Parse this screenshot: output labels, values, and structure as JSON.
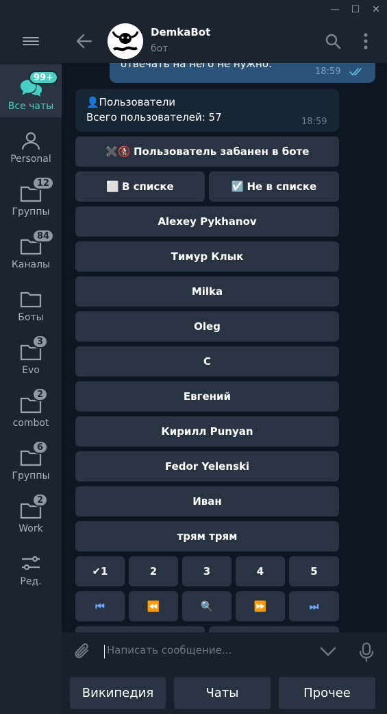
{
  "window": {
    "controls": [
      "—",
      "☐",
      "✕"
    ]
  },
  "sidebar": {
    "folders": [
      {
        "label": "Все чаты",
        "badge": "99+",
        "icon": "chat-bubbles-icon",
        "active": true
      },
      {
        "label": "Personal",
        "badge": "",
        "icon": "person-icon"
      },
      {
        "label": "Группы",
        "badge": "12",
        "icon": "folder-icon"
      },
      {
        "label": "Каналы",
        "badge": "84",
        "icon": "folder-icon"
      },
      {
        "label": "Боты",
        "badge": "",
        "icon": "folder-icon"
      },
      {
        "label": "Evo",
        "badge": "3",
        "icon": "folder-icon"
      },
      {
        "label": "combot",
        "badge": "2",
        "icon": "folder-icon"
      },
      {
        "label": "Группы",
        "badge": "6",
        "icon": "folder-icon"
      },
      {
        "label": "Work",
        "badge": "2",
        "icon": "folder-icon"
      },
      {
        "label": "Ред.",
        "badge": "",
        "icon": "sliders-icon"
      }
    ],
    "accent_color": "#47d0c6"
  },
  "header": {
    "name": "DemkaBot",
    "status": "бот"
  },
  "chat": {
    "previous_message": {
      "text": "отвечать на него не нужно.",
      "time": "18:59"
    },
    "message": {
      "line1": "👤Пользователи",
      "line2": "Всего пользователей: 57",
      "time": "18:59"
    },
    "inline_keyboard": {
      "banned": {
        "icons": "✖️🚷",
        "label": "Пользователь забанен в боте"
      },
      "in_list": {
        "icon": "⬜",
        "label": "В списке"
      },
      "not_in_list": {
        "icon": "☑️",
        "label": "Не в списке"
      },
      "users": [
        "Alexey Pykhanov",
        "Тимур Клык",
        "Milka",
        "Oleg",
        "С",
        "Евгений",
        "Кирилл Punyan",
        "Fedor Yelenski",
        "Иван",
        "трям трям"
      ],
      "pages": [
        "✔1",
        "2",
        "3",
        "4",
        "5"
      ],
      "nav": [
        "⏮",
        "⏪",
        "🔍",
        "⏩",
        "⏭"
      ]
    }
  },
  "composer": {
    "placeholder": "Написать сообщение..."
  },
  "reply_keyboard": [
    "Википедия",
    "Чаты",
    "Прочее"
  ]
}
